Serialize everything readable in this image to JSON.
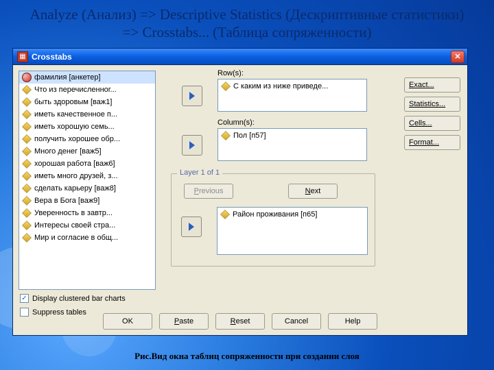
{
  "slide": {
    "title": "Analyze (Анализ) => Descriptive Statistics (Дескриптивные статистики) => Crosstabs... (Таблица сопряженности)",
    "caption": "Рис.Вид окна таблиц сопряженности при создании слоя"
  },
  "window": {
    "title": "Crosstabs",
    "close_label": "✕"
  },
  "variables": [
    {
      "icon": "nominal",
      "label": "фамилия [анкетер]",
      "selected": true
    },
    {
      "icon": "scale",
      "label": "Что из перечисленног..."
    },
    {
      "icon": "scale",
      "label": "быть здоровым [важ1]"
    },
    {
      "icon": "scale",
      "label": "иметь качественное п..."
    },
    {
      "icon": "scale",
      "label": "иметь хорошую семь..."
    },
    {
      "icon": "scale",
      "label": "получить хорошее обр..."
    },
    {
      "icon": "scale",
      "label": "Много денег [важ5]"
    },
    {
      "icon": "scale",
      "label": "хорошая работа [важ6]"
    },
    {
      "icon": "scale",
      "label": "иметь много друзей, з..."
    },
    {
      "icon": "scale",
      "label": "сделать карьеру [важ8]"
    },
    {
      "icon": "scale",
      "label": "Вера в Бога [важ9]"
    },
    {
      "icon": "scale",
      "label": "Уверенность в завтр..."
    },
    {
      "icon": "scale",
      "label": "Интересы своей стра..."
    },
    {
      "icon": "scale",
      "label": "Мир и согласие в общ..."
    }
  ],
  "rows": {
    "label": "Row(s):",
    "items": [
      {
        "icon": "scale",
        "label": "С каким из ниже приведе..."
      }
    ]
  },
  "columns": {
    "label": "Column(s):",
    "items": [
      {
        "icon": "scale",
        "label": "Пол [п57]"
      }
    ]
  },
  "layer": {
    "legend": "Layer 1 of 1",
    "prev": "Previous",
    "next": "Next",
    "items": [
      {
        "icon": "scale",
        "label": "Район проживания [п65]"
      }
    ]
  },
  "option_buttons": {
    "exact": "Exact...",
    "statistics": "Statistics...",
    "cells": "Cells...",
    "format": "Format..."
  },
  "checkboxes": {
    "charts": {
      "label": "Display clustered bar charts",
      "checked": true
    },
    "suppress": {
      "label": "Suppress tables",
      "checked": false
    }
  },
  "buttons": {
    "ok": "OK",
    "paste": "Paste",
    "reset": "Reset",
    "cancel": "Cancel",
    "help": "Help"
  }
}
